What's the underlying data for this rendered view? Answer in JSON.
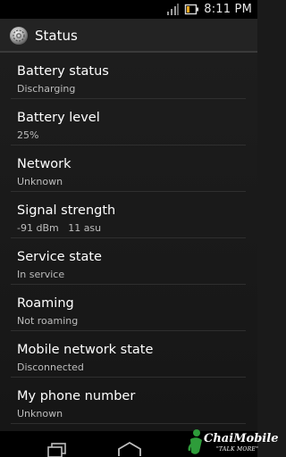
{
  "status_bar": {
    "time": "8:11 PM",
    "signal_icon": "signal-icon",
    "battery_icon": "battery-icon"
  },
  "action_bar": {
    "title": "Status",
    "icon": "settings-gear-icon"
  },
  "items": [
    {
      "title": "Battery status",
      "summary": "Discharging"
    },
    {
      "title": "Battery level",
      "summary": "25%"
    },
    {
      "title": "Network",
      "summary": "Unknown"
    },
    {
      "title": "Signal strength",
      "summary": "-91 dBm   11 asu"
    },
    {
      "title": "Service state",
      "summary": "In service"
    },
    {
      "title": "Roaming",
      "summary": "Not roaming"
    },
    {
      "title": "Mobile network state",
      "summary": "Disconnected"
    },
    {
      "title": "My phone number",
      "summary": "Unknown"
    }
  ],
  "nav_bar": {
    "recents_icon": "recents-icon",
    "home_icon": "home-icon"
  },
  "watermark": {
    "brand": "ChaiMobile",
    "tagline": "\"TALK MORE\""
  },
  "colors": {
    "accent_battery": "#e8a31a",
    "brand_green": "#2e9c3a"
  }
}
